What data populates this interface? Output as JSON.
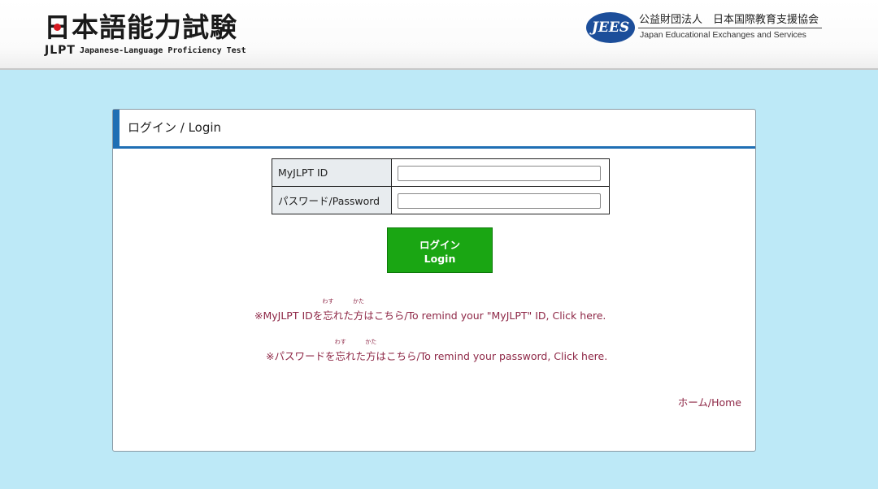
{
  "header": {
    "logo_kanji": "日本語能力試験",
    "logo_jlpt": "JLPT",
    "logo_english": "Japanese-Language Proficiency Test",
    "jees_badge": "JEES",
    "jees_jp": "公益財団法人　日本国際教育支援協会",
    "jees_en": "Japan Educational Exchanges and Services"
  },
  "panel": {
    "title": "ログイン / Login",
    "fields": [
      {
        "label": "MyJLPT ID",
        "value": ""
      },
      {
        "label": "パスワード/Password",
        "value": ""
      }
    ],
    "login_button": {
      "label_jp": "ログイン",
      "label_en": "Login"
    },
    "remind_id": {
      "prefix": "※MyJLPT IDを",
      "word1": "忘",
      "word1_ruby": "わす",
      "mid": "れた",
      "word2": "方",
      "word2_ruby": "かた",
      "suffix": "はこちら/To remind your \"MyJLPT\" ID, Click here."
    },
    "remind_password": {
      "prefix": "※パスワードを",
      "word1": "忘",
      "word1_ruby": "わす",
      "mid": "れた",
      "word2": "方",
      "word2_ruby": "かた",
      "suffix": "はこちら/To remind your password, Click here."
    },
    "home_link": "ホーム/Home"
  },
  "colors": {
    "background": "#bde9f7",
    "accent_blue": "#1f6fb4",
    "login_green": "#1aa613",
    "link_maroon": "#8e2746",
    "hinomaru_red": "#d71920"
  }
}
